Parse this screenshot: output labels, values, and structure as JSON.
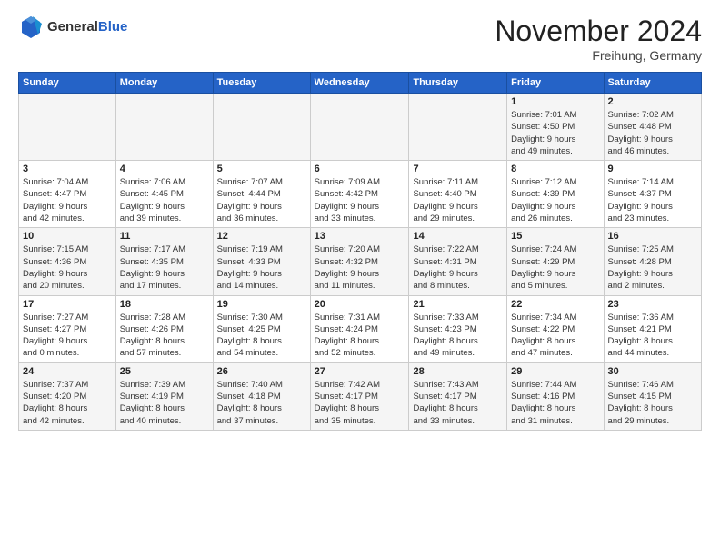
{
  "header": {
    "logo_general": "General",
    "logo_blue": "Blue",
    "month_title": "November 2024",
    "location": "Freihung, Germany"
  },
  "calendar": {
    "days_of_week": [
      "Sunday",
      "Monday",
      "Tuesday",
      "Wednesday",
      "Thursday",
      "Friday",
      "Saturday"
    ],
    "weeks": [
      [
        {
          "day": "",
          "info": ""
        },
        {
          "day": "",
          "info": ""
        },
        {
          "day": "",
          "info": ""
        },
        {
          "day": "",
          "info": ""
        },
        {
          "day": "",
          "info": ""
        },
        {
          "day": "1",
          "info": "Sunrise: 7:01 AM\nSunset: 4:50 PM\nDaylight: 9 hours\nand 49 minutes."
        },
        {
          "day": "2",
          "info": "Sunrise: 7:02 AM\nSunset: 4:48 PM\nDaylight: 9 hours\nand 46 minutes."
        }
      ],
      [
        {
          "day": "3",
          "info": "Sunrise: 7:04 AM\nSunset: 4:47 PM\nDaylight: 9 hours\nand 42 minutes."
        },
        {
          "day": "4",
          "info": "Sunrise: 7:06 AM\nSunset: 4:45 PM\nDaylight: 9 hours\nand 39 minutes."
        },
        {
          "day": "5",
          "info": "Sunrise: 7:07 AM\nSunset: 4:44 PM\nDaylight: 9 hours\nand 36 minutes."
        },
        {
          "day": "6",
          "info": "Sunrise: 7:09 AM\nSunset: 4:42 PM\nDaylight: 9 hours\nand 33 minutes."
        },
        {
          "day": "7",
          "info": "Sunrise: 7:11 AM\nSunset: 4:40 PM\nDaylight: 9 hours\nand 29 minutes."
        },
        {
          "day": "8",
          "info": "Sunrise: 7:12 AM\nSunset: 4:39 PM\nDaylight: 9 hours\nand 26 minutes."
        },
        {
          "day": "9",
          "info": "Sunrise: 7:14 AM\nSunset: 4:37 PM\nDaylight: 9 hours\nand 23 minutes."
        }
      ],
      [
        {
          "day": "10",
          "info": "Sunrise: 7:15 AM\nSunset: 4:36 PM\nDaylight: 9 hours\nand 20 minutes."
        },
        {
          "day": "11",
          "info": "Sunrise: 7:17 AM\nSunset: 4:35 PM\nDaylight: 9 hours\nand 17 minutes."
        },
        {
          "day": "12",
          "info": "Sunrise: 7:19 AM\nSunset: 4:33 PM\nDaylight: 9 hours\nand 14 minutes."
        },
        {
          "day": "13",
          "info": "Sunrise: 7:20 AM\nSunset: 4:32 PM\nDaylight: 9 hours\nand 11 minutes."
        },
        {
          "day": "14",
          "info": "Sunrise: 7:22 AM\nSunset: 4:31 PM\nDaylight: 9 hours\nand 8 minutes."
        },
        {
          "day": "15",
          "info": "Sunrise: 7:24 AM\nSunset: 4:29 PM\nDaylight: 9 hours\nand 5 minutes."
        },
        {
          "day": "16",
          "info": "Sunrise: 7:25 AM\nSunset: 4:28 PM\nDaylight: 9 hours\nand 2 minutes."
        }
      ],
      [
        {
          "day": "17",
          "info": "Sunrise: 7:27 AM\nSunset: 4:27 PM\nDaylight: 9 hours\nand 0 minutes."
        },
        {
          "day": "18",
          "info": "Sunrise: 7:28 AM\nSunset: 4:26 PM\nDaylight: 8 hours\nand 57 minutes."
        },
        {
          "day": "19",
          "info": "Sunrise: 7:30 AM\nSunset: 4:25 PM\nDaylight: 8 hours\nand 54 minutes."
        },
        {
          "day": "20",
          "info": "Sunrise: 7:31 AM\nSunset: 4:24 PM\nDaylight: 8 hours\nand 52 minutes."
        },
        {
          "day": "21",
          "info": "Sunrise: 7:33 AM\nSunset: 4:23 PM\nDaylight: 8 hours\nand 49 minutes."
        },
        {
          "day": "22",
          "info": "Sunrise: 7:34 AM\nSunset: 4:22 PM\nDaylight: 8 hours\nand 47 minutes."
        },
        {
          "day": "23",
          "info": "Sunrise: 7:36 AM\nSunset: 4:21 PM\nDaylight: 8 hours\nand 44 minutes."
        }
      ],
      [
        {
          "day": "24",
          "info": "Sunrise: 7:37 AM\nSunset: 4:20 PM\nDaylight: 8 hours\nand 42 minutes."
        },
        {
          "day": "25",
          "info": "Sunrise: 7:39 AM\nSunset: 4:19 PM\nDaylight: 8 hours\nand 40 minutes."
        },
        {
          "day": "26",
          "info": "Sunrise: 7:40 AM\nSunset: 4:18 PM\nDaylight: 8 hours\nand 37 minutes."
        },
        {
          "day": "27",
          "info": "Sunrise: 7:42 AM\nSunset: 4:17 PM\nDaylight: 8 hours\nand 35 minutes."
        },
        {
          "day": "28",
          "info": "Sunrise: 7:43 AM\nSunset: 4:17 PM\nDaylight: 8 hours\nand 33 minutes."
        },
        {
          "day": "29",
          "info": "Sunrise: 7:44 AM\nSunset: 4:16 PM\nDaylight: 8 hours\nand 31 minutes."
        },
        {
          "day": "30",
          "info": "Sunrise: 7:46 AM\nSunset: 4:15 PM\nDaylight: 8 hours\nand 29 minutes."
        }
      ]
    ]
  }
}
